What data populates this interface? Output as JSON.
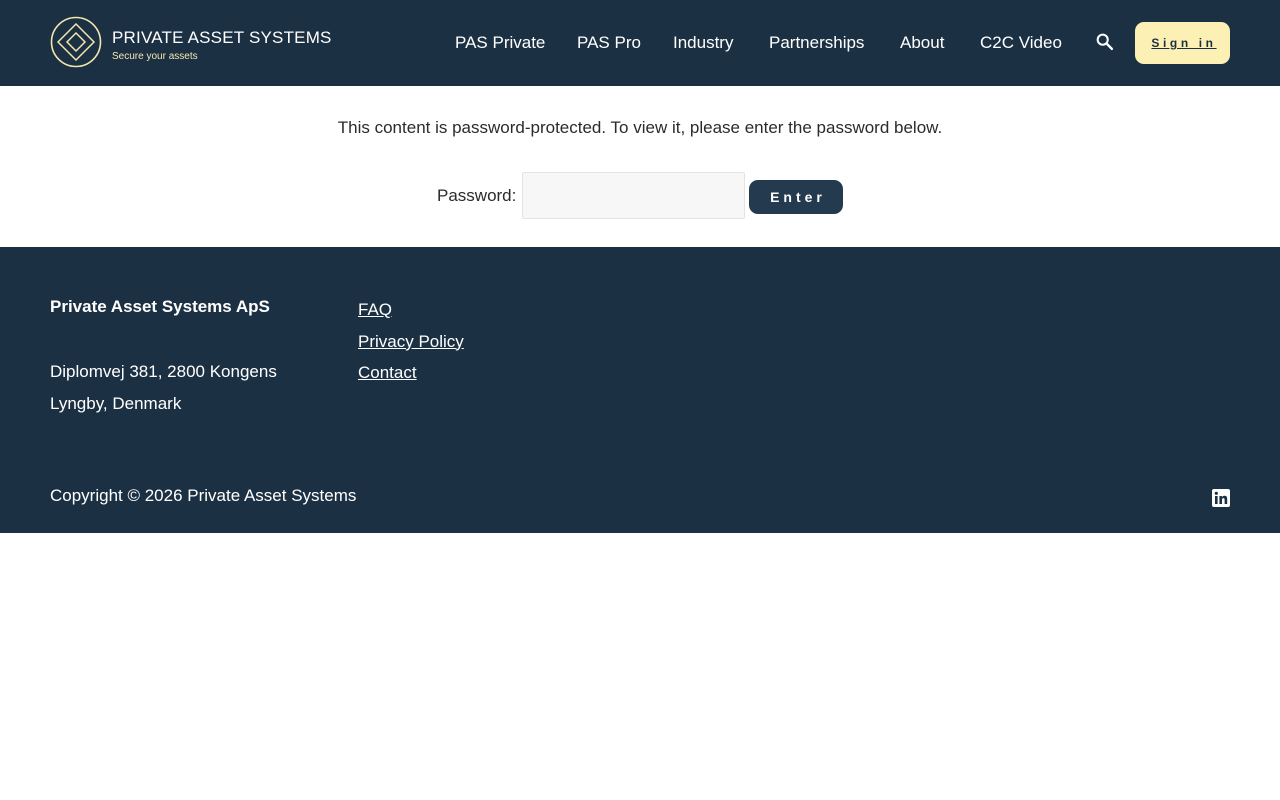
{
  "brand": {
    "title": "PRIVATE ASSET SYSTEMS",
    "tagline": "Secure your assets",
    "accent_color": "#fdf0b4",
    "header_color": "#1c3044",
    "button_color": "#243a4f"
  },
  "nav": {
    "items": [
      {
        "label": "PAS Private"
      },
      {
        "label": "PAS Pro"
      },
      {
        "label": "Industry"
      },
      {
        "label": "Partnerships"
      },
      {
        "label": "About"
      },
      {
        "label": "C2C Video"
      }
    ],
    "search_icon": "search-icon",
    "signin_label": "Sign in"
  },
  "main": {
    "message": "This content is password-protected. To view it, please enter the password below.",
    "password_label": "Password:",
    "password_value": "",
    "submit_label": "Enter"
  },
  "footer": {
    "company_name": "Private Asset Systems ApS",
    "address": "Diplomvej 381, 2800 Kongens Lyngby, Denmark",
    "links": [
      {
        "label": "FAQ"
      },
      {
        "label": "Privacy Policy"
      },
      {
        "label": "Contact"
      }
    ],
    "copyright": "Copyright © 2026 Private Asset Systems",
    "social_icon": "linkedin-icon"
  }
}
